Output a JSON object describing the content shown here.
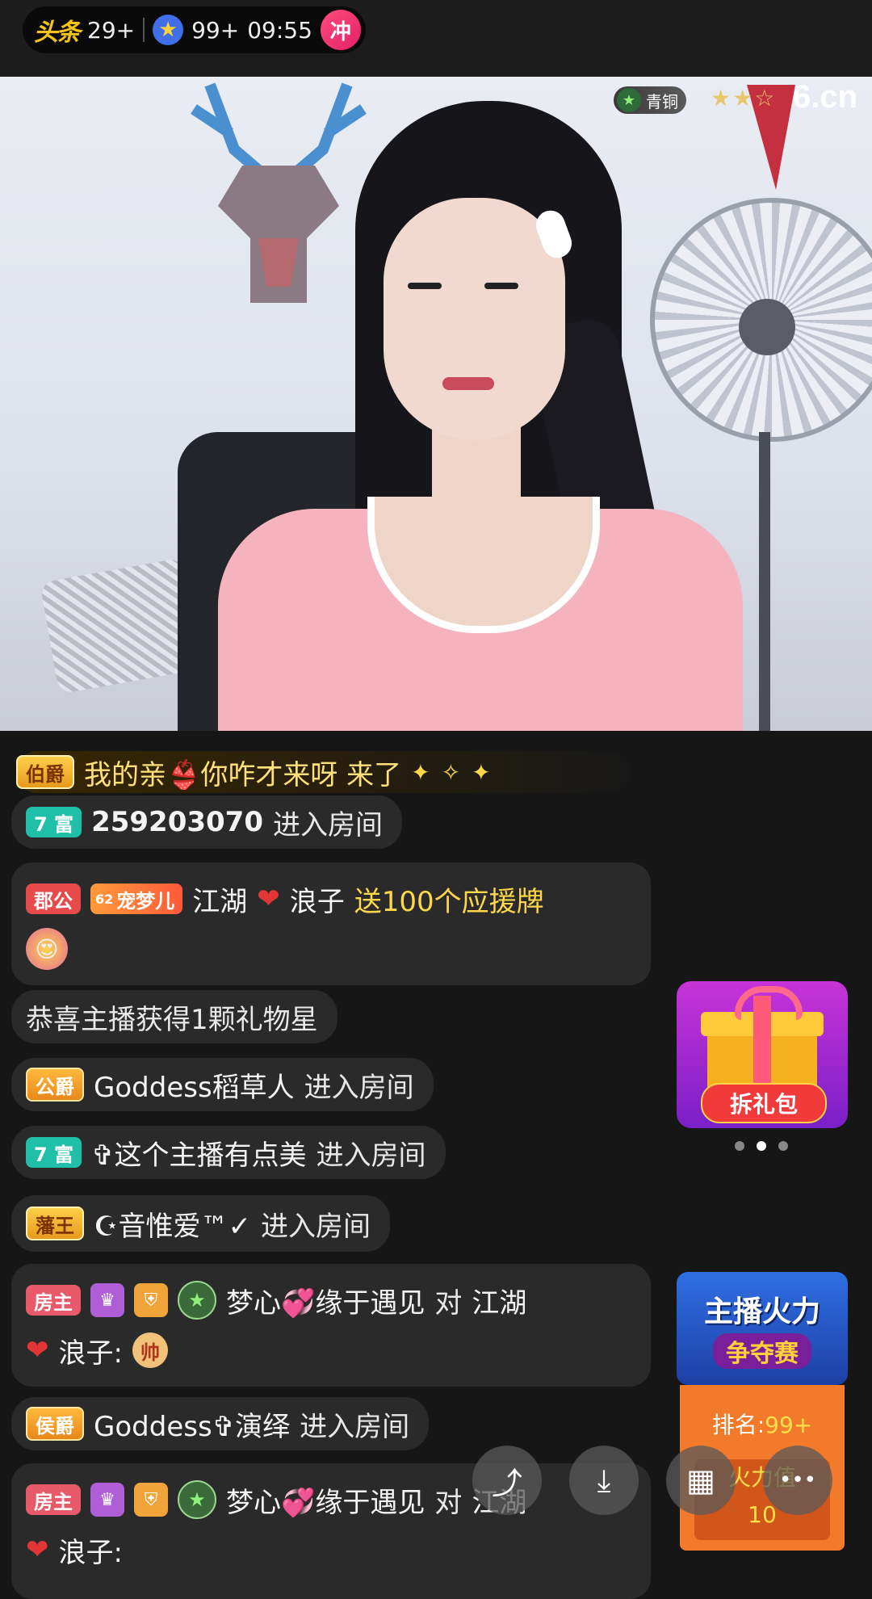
{
  "status_bar": {
    "app_logo": "头条",
    "count1": "29+",
    "count2": "99+",
    "time": "09:55",
    "action_badge": "冲"
  },
  "video": {
    "rank_label": "青铜",
    "stars": "★★☆",
    "site_logo": "6.cn"
  },
  "chat": {
    "welcome": {
      "badge": "伯爵",
      "text": "我的亲👙你咋才来呀 来了",
      "sparkles": "✦✧✦"
    },
    "messages": [
      {
        "badge": "7 富",
        "uid": "259203070",
        "action": "进入房间"
      },
      {
        "badge": "郡公",
        "fan_badge": "宠梦儿",
        "fan_level": "62",
        "user": "江湖",
        "user2": "浪子",
        "gift_text": "送100个应援牌",
        "gift_icon": "😍"
      },
      {
        "text": "恭喜主播获得1颗礼物星"
      },
      {
        "badge": "公爵",
        "user": "Goddess稻草人",
        "action": "进入房间"
      },
      {
        "badge": "7 富",
        "user": "✞这个主播有点美",
        "action": "进入房间"
      },
      {
        "badge": "藩王",
        "user": "☪音惟爱™✓",
        "action": "进入房间"
      },
      {
        "badge": "房主",
        "user": "梦心💞缘于遇见",
        "to": "对",
        "target": "江湖",
        "target2": "浪子:",
        "extra_icon": "帅"
      },
      {
        "badge": "侯爵",
        "user": "Goddess✞演绎",
        "action": "进入房间"
      },
      {
        "badge": "房主",
        "user": "梦心💞缘于遇见",
        "to": "对",
        "target": "江湖",
        "target2": "浪子:"
      }
    ]
  },
  "side": {
    "giftbox_button": "拆礼包",
    "contest_title1": "主播火力",
    "contest_title2": "争夺赛",
    "rank_label": "排名:",
    "rank_value": "99+",
    "fire_label": "火力值",
    "fire_value": "10"
  },
  "fabs": {
    "share": "⤴",
    "download": "⤓",
    "grid": "▦",
    "more": "•••"
  }
}
